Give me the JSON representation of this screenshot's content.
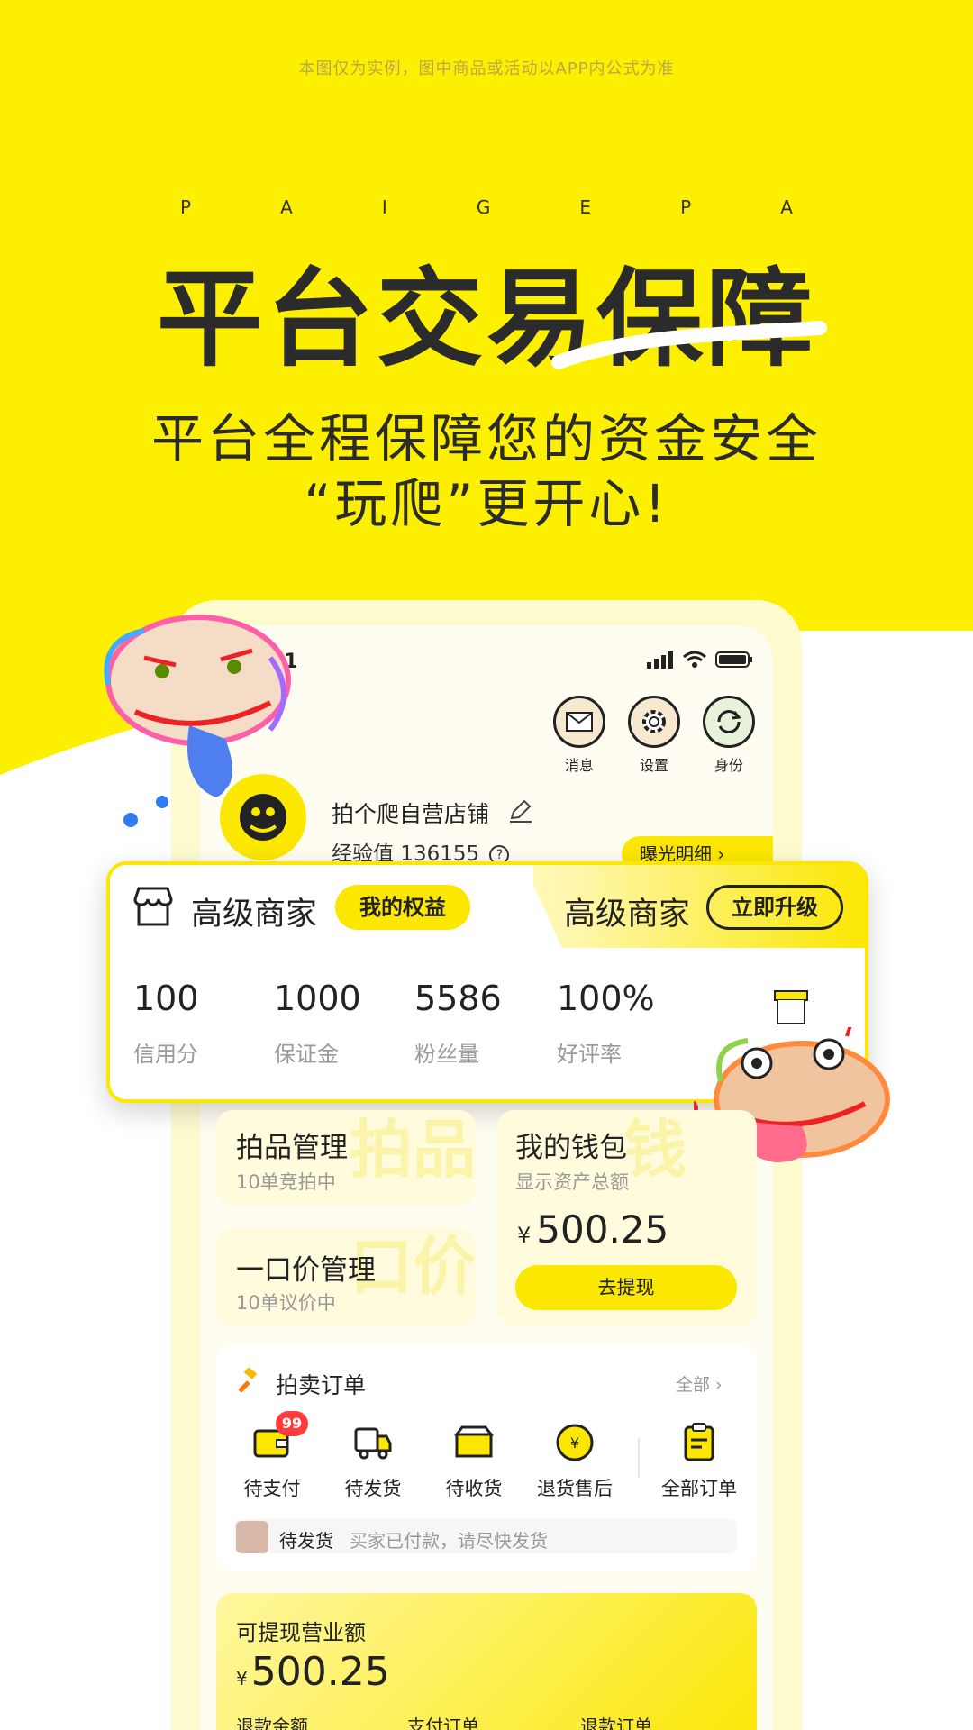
{
  "disclaimer": "本图仅为实例，图中商品或活动以APP内公式为准",
  "letters": [
    "P",
    "A",
    "I",
    "G",
    "E",
    "P",
    "A"
  ],
  "headline": "平台交易保障",
  "subline1": "平台全程保障您的资金安全",
  "subline2": "“玩爬”更开心!",
  "phone": {
    "status_time": "41",
    "top_icons": [
      {
        "label": "消息",
        "icon": "mail-icon"
      },
      {
        "label": "设置",
        "icon": "gear-icon"
      },
      {
        "label": "身份",
        "icon": "refresh-icon"
      }
    ],
    "shop_name": "拍个爬自营店铺",
    "exp_label": "经验值 136155",
    "exposure_btn": "曝光明细",
    "merchant": {
      "level_left": "高级商家",
      "rights_btn": "我的权益",
      "level_right": "高级商家",
      "upgrade_btn": "立即升级",
      "stats": [
        {
          "value": "100",
          "label": "信用分"
        },
        {
          "value": "1000",
          "label": "保证金"
        },
        {
          "value": "5586",
          "label": "粉丝量"
        },
        {
          "value": "100%",
          "label": "好评率"
        }
      ],
      "shop_fragment": "店铺"
    },
    "auction_mgmt": {
      "title": "拍品管理",
      "sub": "10单竞拍中",
      "ghost": "拍品"
    },
    "fixed_price": {
      "title": "一口价管理",
      "sub": "10单议价中",
      "ghost": "口价"
    },
    "wallet": {
      "title": "我的钱包",
      "sub": "显示资产总额",
      "ghost": "钱",
      "currency": "¥",
      "amount": "500.25",
      "button": "去提现"
    },
    "orders": {
      "title": "拍卖订单",
      "all": "全部",
      "badge": "99",
      "items": [
        {
          "label": "待支付",
          "icon": "wallet-icon"
        },
        {
          "label": "待发货",
          "icon": "truck-icon"
        },
        {
          "label": "待收货",
          "icon": "box-icon"
        },
        {
          "label": "退货售后",
          "icon": "yen-coin-icon"
        },
        {
          "label": "全部订单",
          "icon": "clipboard-icon"
        }
      ],
      "notice_tag": "待发货",
      "notice_text": "买家已付款，请尽快发货"
    },
    "revenue": {
      "title": "可提现营业额",
      "currency": "¥",
      "amount": "500.25",
      "columns": [
        "退款金额",
        "支付订单",
        "退款订单"
      ]
    }
  },
  "colors": {
    "brand_yellow": "#fdef00",
    "badge_red": "#ff3b3b",
    "text_dark": "#2b2b2b"
  }
}
